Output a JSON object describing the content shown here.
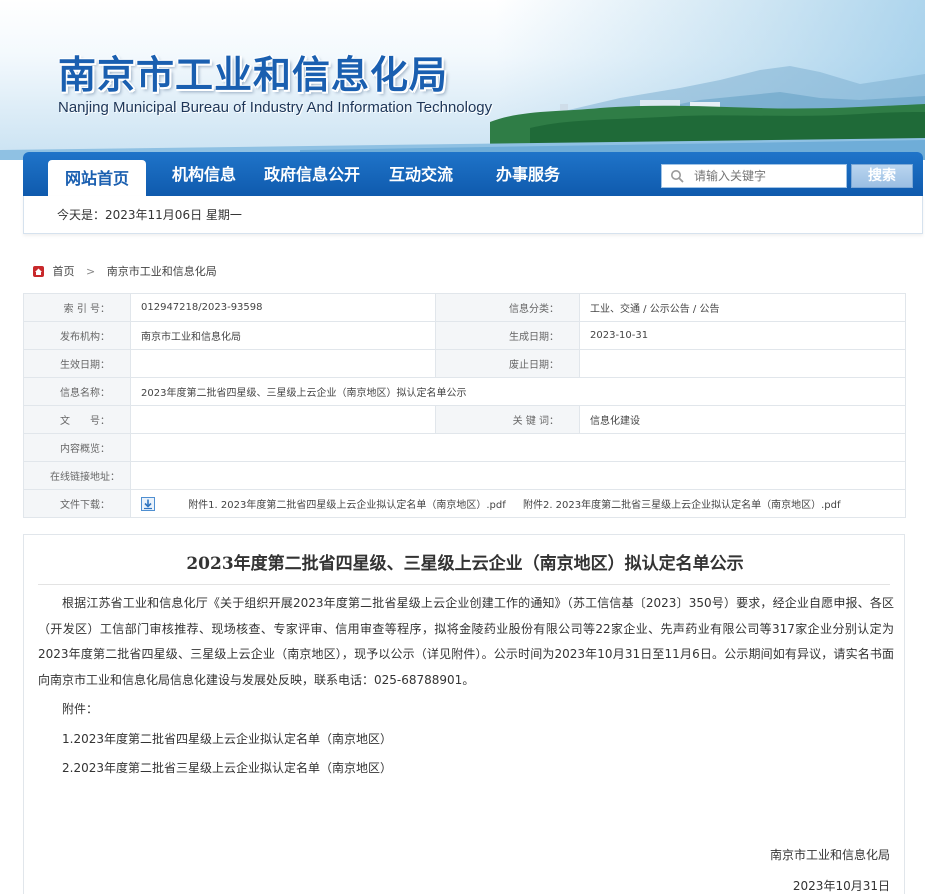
{
  "header": {
    "title": "南京市工业和信息化局",
    "subtitle": "Nanjing Municipal Bureau of Industry And Information Technology"
  },
  "nav": {
    "items": [
      {
        "label": "网站首页",
        "active": true
      },
      {
        "label": "机构信息"
      },
      {
        "label": "政府信息公开"
      },
      {
        "label": "互动交流"
      },
      {
        "label": "办事服务"
      }
    ],
    "search_placeholder": "请输入关键字",
    "search_button": "搜索"
  },
  "datebar": {
    "text": "今天是：2023年11月06日 星期一"
  },
  "breadcrumb": {
    "home": "首页",
    "current": "南京市工业和信息化局"
  },
  "info": {
    "index_label": "索 引 号：",
    "index_value": "012947218/2023-93598",
    "category_label": "信息分类：",
    "category_value": "工业、交通 / 公示公告 / 公告",
    "publisher_label": "发布机构：",
    "publisher_value": "南京市工业和信息化局",
    "created_label": "生成日期：",
    "created_value": "2023-10-31",
    "effective_label": "生效日期：",
    "effective_value": "",
    "expire_label": "废止日期：",
    "expire_value": "",
    "name_label": "信息名称：",
    "name_value": "2023年度第二批省四星级、三星级上云企业（南京地区）拟认定名单公示",
    "docno_label": "文　　号：",
    "docno_value": "",
    "keywords_label": "关 键 词：",
    "keywords_value": "信息化建设",
    "summary_label": "内容概览：",
    "summary_value": "",
    "online_link_label": "在线链接地址：",
    "online_link_value": "",
    "download_label": "文件下载：",
    "attachments": [
      "附件1. 2023年度第二批省四星级上云企业拟认定名单（南京地区）.pdf",
      "附件2. 2023年度第二批省三星级上云企业拟认定名单（南京地区）.pdf"
    ]
  },
  "article": {
    "title": "2023年度第二批省四星级、三星级上云企业（南京地区）拟认定名单公示",
    "body": "根据江苏省工业和信息化厅《关于组织开展2023年度第二批省星级上云企业创建工作的通知》（苏工信信基〔2023〕350号）要求，经企业自愿申报、各区（开发区）工信部门审核推荐、现场核查、专家评审、信用审查等程序，拟将金陵药业股份有限公司等22家企业、先声药业有限公司等317家企业分别认定为2023年度第二批省四星级、三星级上云企业（南京地区），现予以公示（详见附件）。公示时间为2023年10月31日至11月6日。公示期间如有异议，请实名书面向南京市工业和信息化局信息化建设与发展处反映，联系电话：025-68788901。",
    "attach_heading": "附件：",
    "attach_lines": [
      "1.2023年度第二批省四星级上云企业拟认定名单（南京地区）",
      "2.2023年度第二批省三星级上云企业拟认定名单（南京地区）"
    ],
    "signature": "南京市工业和信息化局",
    "date": "2023年10月31日"
  }
}
